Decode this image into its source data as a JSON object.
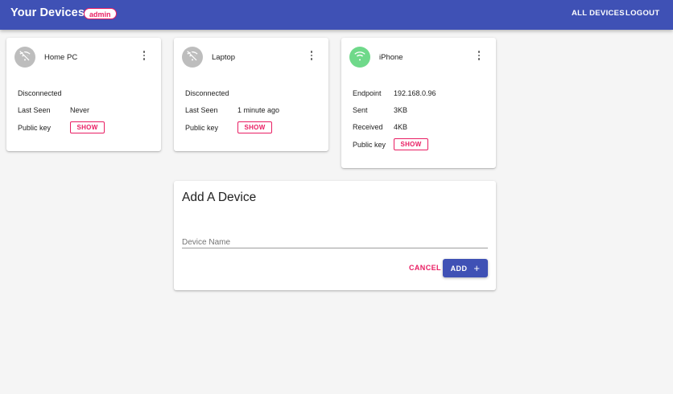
{
  "appbar": {
    "title": "Your Devices",
    "role_badge": "admin",
    "nav": {
      "all_devices": "ALL DEVICES",
      "logout": "LOGOUT"
    }
  },
  "devices": [
    {
      "name": "Home PC",
      "status_icon": "wifi-off-icon",
      "rows": [
        {
          "label": "Disconnected",
          "value": ""
        },
        {
          "label": "Last Seen",
          "value": "Never"
        },
        {
          "label": "Public key",
          "button": "SHOW"
        }
      ]
    },
    {
      "name": "Laptop",
      "status_icon": "wifi-off-icon",
      "rows": [
        {
          "label": "Disconnected",
          "value": ""
        },
        {
          "label": "Last Seen",
          "value": "1 minute ago"
        },
        {
          "label": "Public key",
          "button": "SHOW"
        }
      ]
    },
    {
      "name": "iPhone",
      "status_icon": "wifi-icon",
      "rows": [
        {
          "label": "Endpoint",
          "value": "192.168.0.96"
        },
        {
          "label": "Sent",
          "value": "3KB"
        },
        {
          "label": "Received",
          "value": "4KB"
        },
        {
          "label": "Public key",
          "button": "SHOW"
        }
      ]
    }
  ],
  "add_device": {
    "title": "Add A Device",
    "name_placeholder": "Device Name",
    "name_value": "",
    "cancel_label": "CANCEL",
    "add_label": "ADD"
  },
  "colors": {
    "primary": "#3f51b5",
    "accent": "#e91e63",
    "online": "#6fd98a",
    "offline": "#bdbdbd"
  }
}
